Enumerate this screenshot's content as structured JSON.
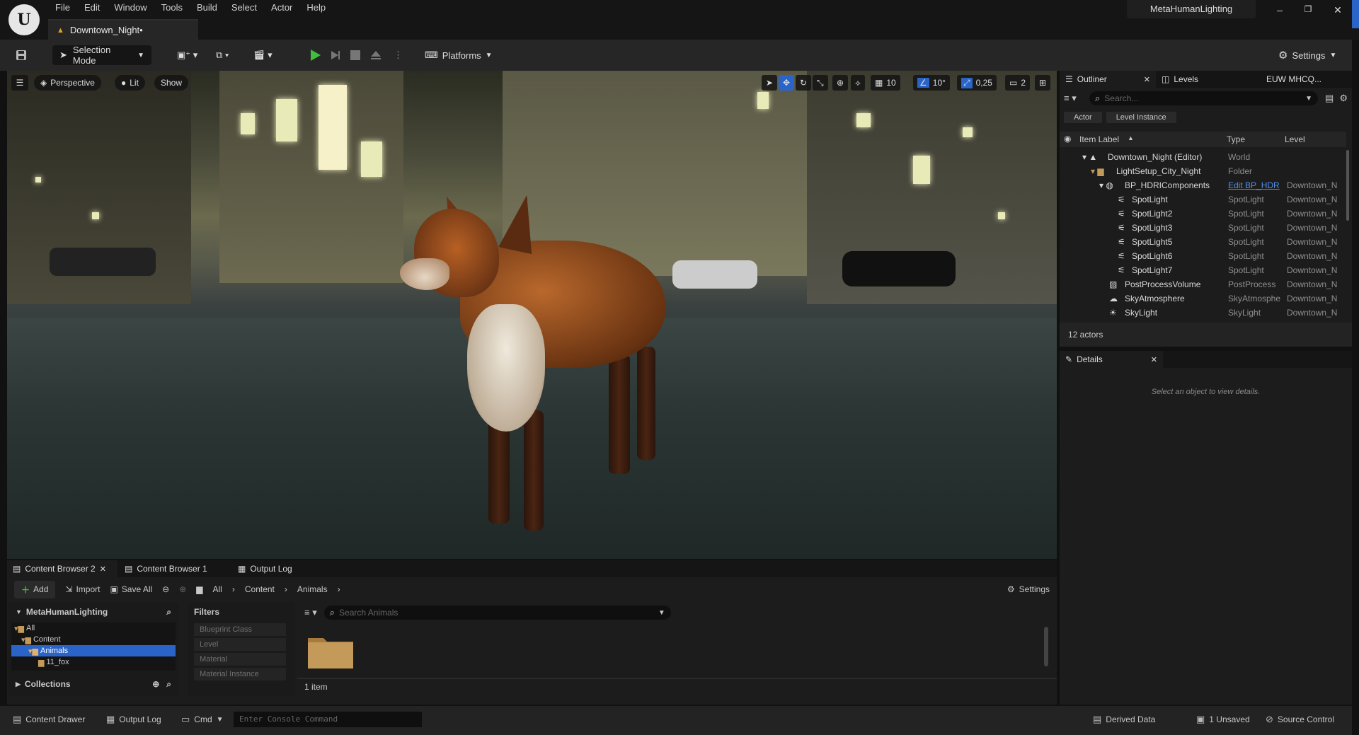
{
  "app": {
    "logo_text": "U",
    "project_name": "MetaHumanLighting"
  },
  "menu": [
    "File",
    "Edit",
    "Window",
    "Tools",
    "Build",
    "Select",
    "Actor",
    "Help"
  ],
  "document_tab": {
    "label": "Downtown_Night•"
  },
  "window_controls": {
    "minimize": "–",
    "restore": "❐",
    "close": "✕"
  },
  "toolbar": {
    "save_icon": "save-icon",
    "selection_mode": "Selection Mode",
    "platforms": "Platforms",
    "settings": "Settings"
  },
  "viewport": {
    "perspective": "Perspective",
    "lit": "Lit",
    "show": "Show",
    "grid_snap": "10",
    "rot_snap": "10°",
    "scale_snap": "0,25",
    "camera_speed": "2"
  },
  "outliner": {
    "tab_outliner": "Outliner",
    "tab_levels": "Levels",
    "tab_extra": "EUW MHCQ...",
    "search_placeholder": "Search...",
    "filter_actor": "Actor",
    "filter_level_instance": "Level Instance",
    "col_label": "Item Label",
    "col_type": "Type",
    "col_level": "Level",
    "rows": [
      {
        "label": "Downtown_Night (Editor)",
        "type": "World",
        "level": ""
      },
      {
        "label": "LightSetup_City_Night",
        "type": "Folder",
        "level": ""
      },
      {
        "label": "BP_HDRIComponents",
        "type": "Edit BP_HDR",
        "level": "Downtown_N"
      },
      {
        "label": "SpotLight",
        "type": "SpotLight",
        "level": "Downtown_N"
      },
      {
        "label": "SpotLight2",
        "type": "SpotLight",
        "level": "Downtown_N"
      },
      {
        "label": "SpotLight3",
        "type": "SpotLight",
        "level": "Downtown_N"
      },
      {
        "label": "SpotLight5",
        "type": "SpotLight",
        "level": "Downtown_N"
      },
      {
        "label": "SpotLight6",
        "type": "SpotLight",
        "level": "Downtown_N"
      },
      {
        "label": "SpotLight7",
        "type": "SpotLight",
        "level": "Downtown_N"
      },
      {
        "label": "PostProcessVolume",
        "type": "PostProcess",
        "level": "Downtown_N"
      },
      {
        "label": "SkyAtmosphere",
        "type": "SkyAtmosphe",
        "level": "Downtown_N"
      },
      {
        "label": "SkyLight",
        "type": "SkyLight",
        "level": "Downtown_N"
      }
    ],
    "actor_count": "12 actors"
  },
  "details": {
    "tab": "Details",
    "empty_text": "Select an object to view details."
  },
  "content_browser": {
    "tabs": [
      "Content Browser 2",
      "Content Browser 1",
      "Output Log"
    ],
    "add": "Add",
    "import": "Import",
    "save_all": "Save All",
    "path": [
      "All",
      "Content",
      "Animals"
    ],
    "settings": "Settings",
    "tree_root": "MetaHumanLighting",
    "tree": [
      "All",
      "Content",
      "Animals",
      "11_fox"
    ],
    "collections": "Collections",
    "filters_title": "Filters",
    "filters": [
      "Blueprint Class",
      "Level",
      "Material",
      "Material Instance"
    ],
    "search_placeholder": "Search Animals",
    "item_count": "1 item"
  },
  "statusbar": {
    "content_drawer": "Content Drawer",
    "output_log": "Output Log",
    "cmd": "Cmd",
    "console_placeholder": "Enter Console Command",
    "derived_data": "Derived Data",
    "unsaved": "1 Unsaved",
    "source_control": "Source Control"
  },
  "colors": {
    "accent": "#2a64c8",
    "play_green": "#3fbf3f",
    "folder": "#c49a5a"
  }
}
